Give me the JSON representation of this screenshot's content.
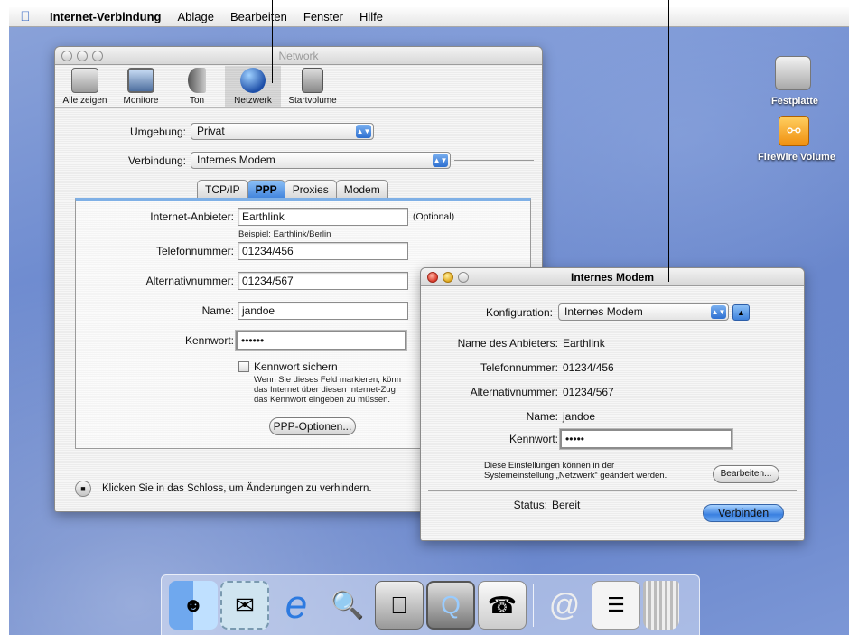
{
  "menubar": {
    "app": "Internet-Verbindung",
    "items": [
      "Ablage",
      "Bearbeiten",
      "Fenster",
      "Hilfe"
    ]
  },
  "network_window": {
    "title": "Network",
    "toolbar": [
      "Alle zeigen",
      "Monitore",
      "Ton",
      "Netzwerk",
      "Startvolume"
    ],
    "umgebung_label": "Umgebung:",
    "umgebung_value": "Privat",
    "verbindung_label": "Verbindung:",
    "verbindung_value": "Internes Modem",
    "tabs": [
      "TCP/IP",
      "PPP",
      "Proxies",
      "Modem"
    ],
    "provider_label": "Internet-Anbieter:",
    "provider_value": "Earthlink",
    "provider_optional": "(Optional)",
    "provider_example": "Beispiel: Earthlink/Berlin",
    "phone_label": "Telefonnummer:",
    "phone_value": "01234/456",
    "alt_label": "Alternativnummer:",
    "alt_value": "01234/567",
    "name_label": "Name:",
    "name_value": "jandoe",
    "password_label": "Kennwort:",
    "password_value": "••••••",
    "save_pw_label": "Kennwort sichern",
    "save_pw_help": [
      "Wenn Sie dieses Feld markieren, könn",
      "das Internet über diesen Internet-Zug",
      "das Kennwort eingeben zu müssen."
    ],
    "ppp_options": "PPP-Optionen...",
    "lock_text": "Klicken Sie in das Schloss, um Änderungen zu verhindern."
  },
  "modem_window": {
    "title": "Internes Modem",
    "config_label": "Konfiguration:",
    "config_value": "Internes Modem",
    "provider_label": "Name des Anbieters:",
    "provider_value": "Earthlink",
    "phone_label": "Telefonnummer:",
    "phone_value": "01234/456",
    "alt_label": "Alternativnummer:",
    "alt_value": "01234/567",
    "name_label": "Name:",
    "name_value": "jandoe",
    "password_label": "Kennwort:",
    "password_value": "•••••",
    "note_line1": "Diese Einstellungen können in der",
    "note_line2": "Systemeinstellung „Netzwerk“ geändert werden.",
    "edit_button": "Bearbeiten...",
    "status_label": "Status:",
    "status_value": "Bereit",
    "connect_button": "Verbinden"
  },
  "desktop_icons": [
    "Festplatte",
    "FireWire Volume"
  ]
}
